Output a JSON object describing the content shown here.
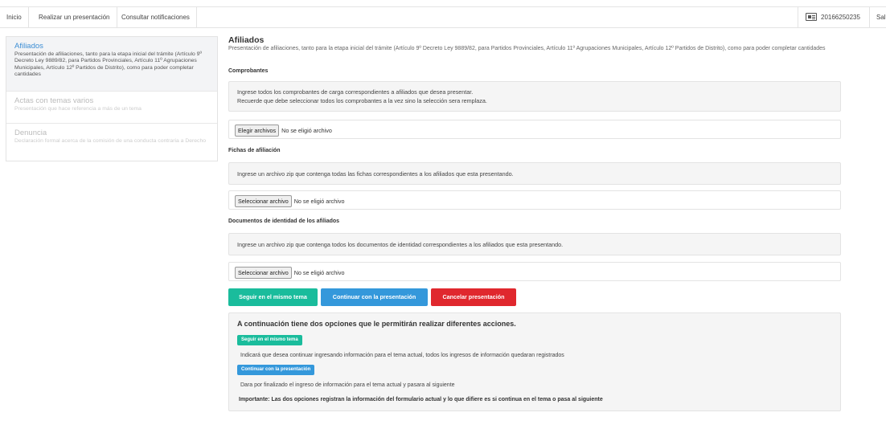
{
  "nav": {
    "items": [
      "Inicio",
      "Realizar un presentación",
      "Consultar notificaciones"
    ],
    "user_id": "20166250235",
    "logout": "Sal"
  },
  "sidebar": {
    "items": [
      {
        "title": "Afiliados",
        "desc": "Presentación de afiliaciones, tanto para la etapa inicial del trámite (Artículo 9º Decreto Ley 9889/82, para Partidos Provinciales, Artículo 11º Agrupaciones Municipales, Artículo 12º Partidos de Distrito), como para poder completar cantidades",
        "active": true
      },
      {
        "title": "Actas con temas varios",
        "desc": "Presentación que hace referencia a más de un tema",
        "active": false
      },
      {
        "title": "Denuncia",
        "desc": "Declaración formal acerca de la comisión de una conducta contraria a Derecho",
        "active": false
      }
    ]
  },
  "main": {
    "title": "Afiliados",
    "desc": "Presentación de afiliaciones, tanto para la etapa inicial del trámite (Artículo 9º Decreto Ley 9889/82, para Partidos Provinciales, Artículo 11º Agrupaciones Municipales, Artículo 12º Partidos de Distrito), como para poder completar cantidades",
    "sections": [
      {
        "label": "Comprobantes",
        "info_line1": "Ingrese todos los comprobantes de carga correspondientes a afiliados que desea presentar.",
        "info_line2": "Recuerde que debe seleccionar todos los comprobantes a la vez sino la selección sera remplaza.",
        "file_button": "Elegir archivos",
        "file_status": "No se eligió archivo"
      },
      {
        "label": "Fichas de afiliación",
        "info_line1": "Ingrese un archivo zip que contenga todas las fichas correspondientes a los afiliados que esta presentando.",
        "file_button": "Seleccionar archivo",
        "file_status": "No se eligió archivo"
      },
      {
        "label": "Documentos de identidad de los afiliados",
        "info_line1": "Ingrese un archivo zip que contenga todos los documentos de identidad correspondientes a los afiliados que esta presentando.",
        "file_button": "Seleccionar archivo",
        "file_status": "No se eligió archivo"
      }
    ],
    "buttons": {
      "stay": "Seguir en el mismo tema",
      "continue": "Continuar con la presentación",
      "cancel": "Cancelar presentación"
    },
    "info": {
      "title": "A continuación tiene dos opciones que le permitirán realizar diferentes acciones.",
      "stay_label": "Seguir en el mismo tema",
      "stay_desc": "Indicará que desea continuar ingresando información para el tema actual, todos los ingresos de información quedaran registrados",
      "continue_label": "Continuar con la presentación",
      "continue_desc": "Dara por finalizado el ingreso de información para el tema actual y pasara al siguiente",
      "important": "Importante: Las dos opciones registran la información del formulario actual y lo que difiere es si continua en el tema o pasa al siguiente"
    }
  },
  "colors": {
    "accent_blue": "#3498db",
    "teal": "#1abc9c",
    "red": "#e0282e",
    "sidebar_active_title": "#3d8ed4"
  },
  "icons": {
    "user": "id-card-icon"
  }
}
